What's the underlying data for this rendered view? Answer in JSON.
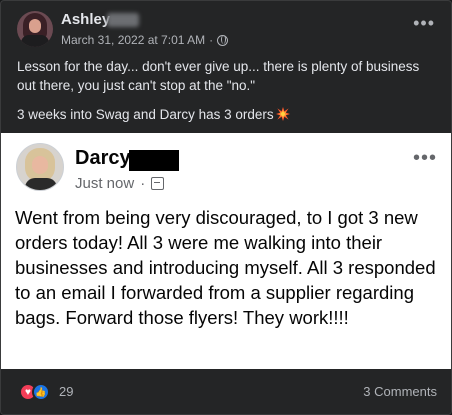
{
  "post": {
    "author": "Ashley",
    "timestamp": "March 31, 2022 at 7:01 AM",
    "meta_separator": "·",
    "privacy_icon": "globe-icon",
    "more_label": "•••",
    "caption_line1": "Lesson for the day... don't ever give up... there is plenty of business out there, you just can't stop at the \"no.\"",
    "caption_line2": "3 weeks into Swag and Darcy has 3 orders",
    "caption_emoji": "collision-icon"
  },
  "shared_post": {
    "author": "Darcy",
    "time": "Just now",
    "meta_separator": "·",
    "audience_icon": "image-icon",
    "more_label": "•••",
    "text": "Went from being very discouraged, to I got 3 new orders today!  All 3 were me walking into their businesses and introducing myself.  All 3 responded to an email I forwarded from a supplier regarding bags.  Forward those flyers!  They work!!!!"
  },
  "reactions": {
    "icons": [
      "love-icon",
      "like-icon"
    ],
    "count": "29",
    "comments": "3 Comments"
  },
  "colors": {
    "background": "#242526",
    "love": "#f33e58",
    "like": "#1b74e4"
  }
}
